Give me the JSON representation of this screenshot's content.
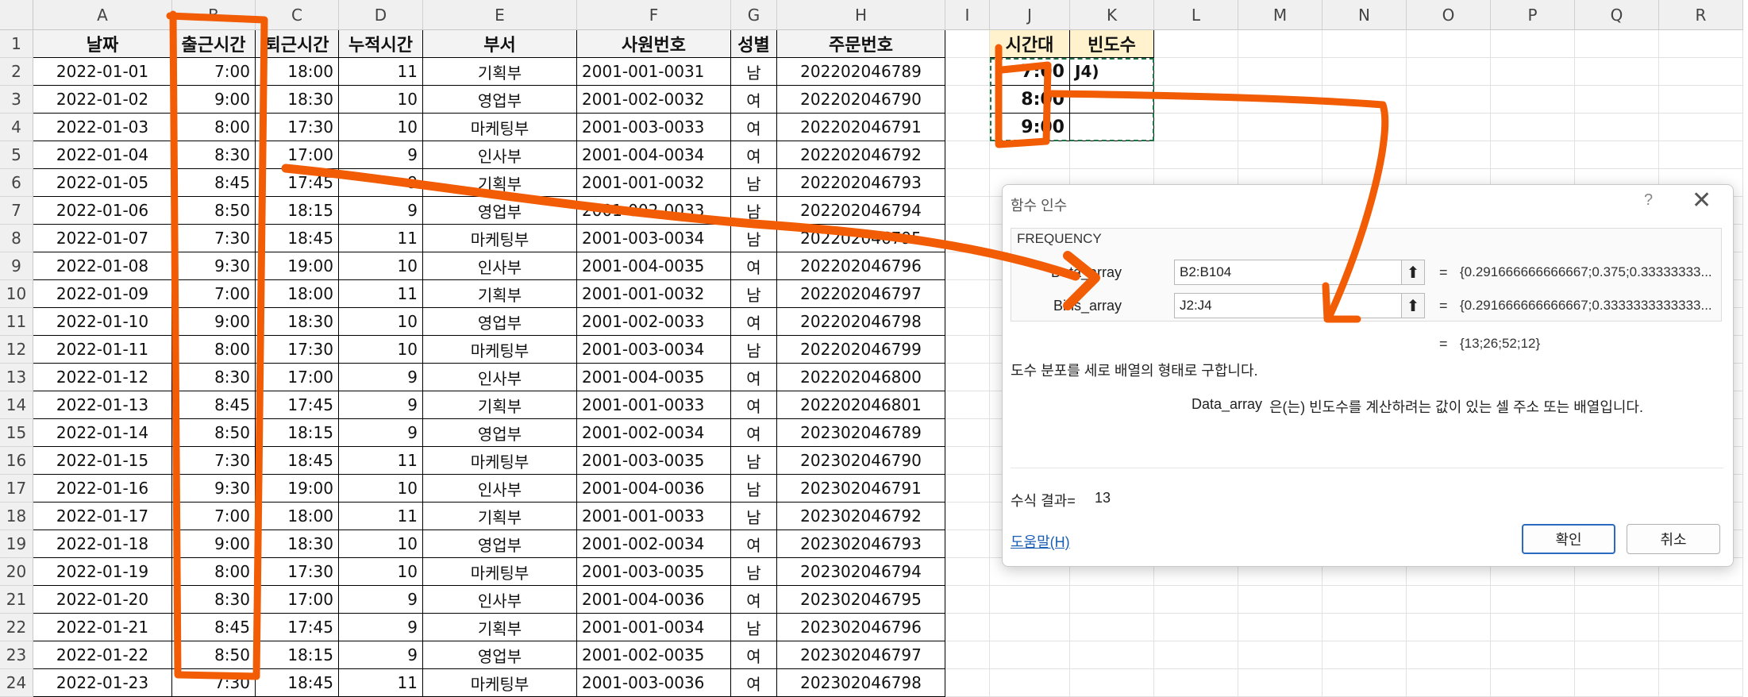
{
  "columns": [
    "A",
    "B",
    "C",
    "D",
    "E",
    "F",
    "G",
    "H",
    "I",
    "J",
    "K",
    "L",
    "M",
    "N",
    "O",
    "P",
    "Q",
    "R"
  ],
  "rows": [
    "1",
    "2",
    "3",
    "4",
    "5",
    "6",
    "7",
    "8",
    "9",
    "10",
    "11",
    "12",
    "13",
    "14",
    "15",
    "16",
    "17",
    "18",
    "19",
    "20",
    "21",
    "22",
    "23",
    "24"
  ],
  "table": {
    "headers": [
      "날짜",
      "출근시간",
      "퇴근시간",
      "누적시간",
      "부서",
      "사원번호",
      "성별",
      "주문번호"
    ],
    "records": [
      [
        "2022-01-01",
        "7:00",
        "18:00",
        "11",
        "기획부",
        "2001-001-0031",
        "남",
        "202202046789"
      ],
      [
        "2022-01-02",
        "9:00",
        "18:30",
        "10",
        "영업부",
        "2001-002-0032",
        "여",
        "202202046790"
      ],
      [
        "2022-01-03",
        "8:00",
        "17:30",
        "10",
        "마케팅부",
        "2001-003-0033",
        "여",
        "202202046791"
      ],
      [
        "2022-01-04",
        "8:30",
        "17:00",
        "9",
        "인사부",
        "2001-004-0034",
        "여",
        "202202046792"
      ],
      [
        "2022-01-05",
        "8:45",
        "17:45",
        "9",
        "기획부",
        "2001-001-0032",
        "남",
        "202202046793"
      ],
      [
        "2022-01-06",
        "8:50",
        "18:15",
        "9",
        "영업부",
        "2001-002-0033",
        "남",
        "202202046794"
      ],
      [
        "2022-01-07",
        "7:30",
        "18:45",
        "11",
        "마케팅부",
        "2001-003-0034",
        "남",
        "202202046795"
      ],
      [
        "2022-01-08",
        "9:30",
        "19:00",
        "10",
        "인사부",
        "2001-004-0035",
        "여",
        "202202046796"
      ],
      [
        "2022-01-09",
        "7:00",
        "18:00",
        "11",
        "기획부",
        "2001-001-0032",
        "남",
        "202202046797"
      ],
      [
        "2022-01-10",
        "9:00",
        "18:30",
        "10",
        "영업부",
        "2001-002-0033",
        "여",
        "202202046798"
      ],
      [
        "2022-01-11",
        "8:00",
        "17:30",
        "10",
        "마케팅부",
        "2001-003-0034",
        "남",
        "202202046799"
      ],
      [
        "2022-01-12",
        "8:30",
        "17:00",
        "9",
        "인사부",
        "2001-004-0035",
        "여",
        "202202046800"
      ],
      [
        "2022-01-13",
        "8:45",
        "17:45",
        "9",
        "기획부",
        "2001-001-0033",
        "여",
        "202202046801"
      ],
      [
        "2022-01-14",
        "8:50",
        "18:15",
        "9",
        "영업부",
        "2001-002-0034",
        "여",
        "202302046789"
      ],
      [
        "2022-01-15",
        "7:30",
        "18:45",
        "11",
        "마케팅부",
        "2001-003-0035",
        "남",
        "202302046790"
      ],
      [
        "2022-01-16",
        "9:30",
        "19:00",
        "10",
        "인사부",
        "2001-004-0036",
        "남",
        "202302046791"
      ],
      [
        "2022-01-17",
        "7:00",
        "18:00",
        "11",
        "기획부",
        "2001-001-0033",
        "남",
        "202302046792"
      ],
      [
        "2022-01-18",
        "9:00",
        "18:30",
        "10",
        "영업부",
        "2001-002-0034",
        "여",
        "202302046793"
      ],
      [
        "2022-01-19",
        "8:00",
        "17:30",
        "10",
        "마케팅부",
        "2001-003-0035",
        "남",
        "202302046794"
      ],
      [
        "2022-01-20",
        "8:30",
        "17:00",
        "9",
        "인사부",
        "2001-004-0036",
        "여",
        "202302046795"
      ],
      [
        "2022-01-21",
        "8:45",
        "17:45",
        "9",
        "기획부",
        "2001-001-0034",
        "남",
        "202302046796"
      ],
      [
        "2022-01-22",
        "8:50",
        "18:15",
        "9",
        "영업부",
        "2001-002-0035",
        "여",
        "202302046797"
      ],
      [
        "2022-01-23",
        "7:30",
        "18:45",
        "11",
        "마케팅부",
        "2001-003-0036",
        "여",
        "202302046798"
      ]
    ]
  },
  "bins": {
    "headers": [
      "시간대",
      "빈도수"
    ],
    "values": [
      "7:00",
      "8:00",
      "9:00"
    ],
    "k2_text": "J4)"
  },
  "dialog": {
    "title": "함수 인수",
    "help_symbol": "?",
    "close_symbol": "✕",
    "function_name": "FREQUENCY",
    "args": [
      {
        "label": "Data_array",
        "value": "B2:B104",
        "result": "{0.291666666666667;0.375;0.33333333..."
      },
      {
        "label": "Bins_array",
        "value": "J2:J4",
        "result": "{0.291666666666667;0.3333333333333..."
      }
    ],
    "eq": "=",
    "array_result": "{13;26;52;12}",
    "description": "도수 분포를 세로 배열의 형태로 구합니다.",
    "arg_name": "Data_array",
    "arg_description": "은(는) 빈도수를 계산하려는 값이 있는 셀 주소 또는 배열입니다.",
    "formula_result_label": "수식 결과=",
    "formula_result_value": "13",
    "help_link": "도움말(H)",
    "ok_label": "확인",
    "cancel_label": "취소"
  },
  "colors": {
    "annotation": "#f25c05",
    "bin_header": "#fff2cc"
  }
}
